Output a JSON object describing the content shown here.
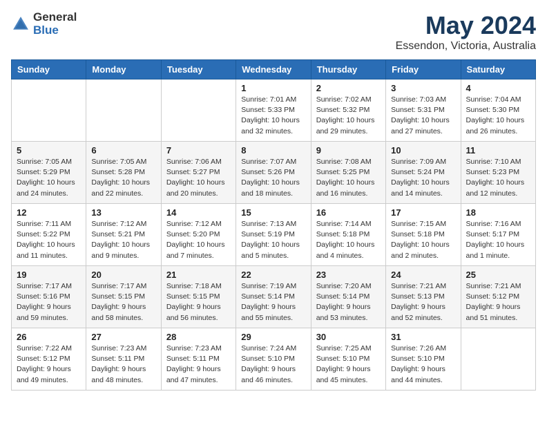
{
  "header": {
    "logo_general": "General",
    "logo_blue": "Blue",
    "month_title": "May 2024",
    "location": "Essendon, Victoria, Australia"
  },
  "weekdays": [
    "Sunday",
    "Monday",
    "Tuesday",
    "Wednesday",
    "Thursday",
    "Friday",
    "Saturday"
  ],
  "weeks": [
    [
      {
        "day": "",
        "info": ""
      },
      {
        "day": "",
        "info": ""
      },
      {
        "day": "",
        "info": ""
      },
      {
        "day": "1",
        "info": "Sunrise: 7:01 AM\nSunset: 5:33 PM\nDaylight: 10 hours\nand 32 minutes."
      },
      {
        "day": "2",
        "info": "Sunrise: 7:02 AM\nSunset: 5:32 PM\nDaylight: 10 hours\nand 29 minutes."
      },
      {
        "day": "3",
        "info": "Sunrise: 7:03 AM\nSunset: 5:31 PM\nDaylight: 10 hours\nand 27 minutes."
      },
      {
        "day": "4",
        "info": "Sunrise: 7:04 AM\nSunset: 5:30 PM\nDaylight: 10 hours\nand 26 minutes."
      }
    ],
    [
      {
        "day": "5",
        "info": "Sunrise: 7:05 AM\nSunset: 5:29 PM\nDaylight: 10 hours\nand 24 minutes."
      },
      {
        "day": "6",
        "info": "Sunrise: 7:05 AM\nSunset: 5:28 PM\nDaylight: 10 hours\nand 22 minutes."
      },
      {
        "day": "7",
        "info": "Sunrise: 7:06 AM\nSunset: 5:27 PM\nDaylight: 10 hours\nand 20 minutes."
      },
      {
        "day": "8",
        "info": "Sunrise: 7:07 AM\nSunset: 5:26 PM\nDaylight: 10 hours\nand 18 minutes."
      },
      {
        "day": "9",
        "info": "Sunrise: 7:08 AM\nSunset: 5:25 PM\nDaylight: 10 hours\nand 16 minutes."
      },
      {
        "day": "10",
        "info": "Sunrise: 7:09 AM\nSunset: 5:24 PM\nDaylight: 10 hours\nand 14 minutes."
      },
      {
        "day": "11",
        "info": "Sunrise: 7:10 AM\nSunset: 5:23 PM\nDaylight: 10 hours\nand 12 minutes."
      }
    ],
    [
      {
        "day": "12",
        "info": "Sunrise: 7:11 AM\nSunset: 5:22 PM\nDaylight: 10 hours\nand 11 minutes."
      },
      {
        "day": "13",
        "info": "Sunrise: 7:12 AM\nSunset: 5:21 PM\nDaylight: 10 hours\nand 9 minutes."
      },
      {
        "day": "14",
        "info": "Sunrise: 7:12 AM\nSunset: 5:20 PM\nDaylight: 10 hours\nand 7 minutes."
      },
      {
        "day": "15",
        "info": "Sunrise: 7:13 AM\nSunset: 5:19 PM\nDaylight: 10 hours\nand 5 minutes."
      },
      {
        "day": "16",
        "info": "Sunrise: 7:14 AM\nSunset: 5:18 PM\nDaylight: 10 hours\nand 4 minutes."
      },
      {
        "day": "17",
        "info": "Sunrise: 7:15 AM\nSunset: 5:18 PM\nDaylight: 10 hours\nand 2 minutes."
      },
      {
        "day": "18",
        "info": "Sunrise: 7:16 AM\nSunset: 5:17 PM\nDaylight: 10 hours\nand 1 minute."
      }
    ],
    [
      {
        "day": "19",
        "info": "Sunrise: 7:17 AM\nSunset: 5:16 PM\nDaylight: 9 hours\nand 59 minutes."
      },
      {
        "day": "20",
        "info": "Sunrise: 7:17 AM\nSunset: 5:15 PM\nDaylight: 9 hours\nand 58 minutes."
      },
      {
        "day": "21",
        "info": "Sunrise: 7:18 AM\nSunset: 5:15 PM\nDaylight: 9 hours\nand 56 minutes."
      },
      {
        "day": "22",
        "info": "Sunrise: 7:19 AM\nSunset: 5:14 PM\nDaylight: 9 hours\nand 55 minutes."
      },
      {
        "day": "23",
        "info": "Sunrise: 7:20 AM\nSunset: 5:14 PM\nDaylight: 9 hours\nand 53 minutes."
      },
      {
        "day": "24",
        "info": "Sunrise: 7:21 AM\nSunset: 5:13 PM\nDaylight: 9 hours\nand 52 minutes."
      },
      {
        "day": "25",
        "info": "Sunrise: 7:21 AM\nSunset: 5:12 PM\nDaylight: 9 hours\nand 51 minutes."
      }
    ],
    [
      {
        "day": "26",
        "info": "Sunrise: 7:22 AM\nSunset: 5:12 PM\nDaylight: 9 hours\nand 49 minutes."
      },
      {
        "day": "27",
        "info": "Sunrise: 7:23 AM\nSunset: 5:11 PM\nDaylight: 9 hours\nand 48 minutes."
      },
      {
        "day": "28",
        "info": "Sunrise: 7:23 AM\nSunset: 5:11 PM\nDaylight: 9 hours\nand 47 minutes."
      },
      {
        "day": "29",
        "info": "Sunrise: 7:24 AM\nSunset: 5:10 PM\nDaylight: 9 hours\nand 46 minutes."
      },
      {
        "day": "30",
        "info": "Sunrise: 7:25 AM\nSunset: 5:10 PM\nDaylight: 9 hours\nand 45 minutes."
      },
      {
        "day": "31",
        "info": "Sunrise: 7:26 AM\nSunset: 5:10 PM\nDaylight: 9 hours\nand 44 minutes."
      },
      {
        "day": "",
        "info": ""
      }
    ]
  ]
}
